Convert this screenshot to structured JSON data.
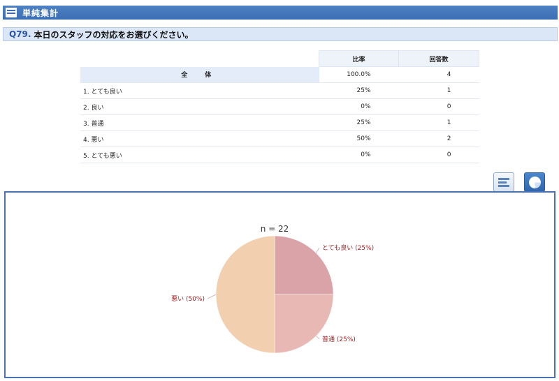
{
  "header": {
    "title": "単純集計",
    "icon": "list-icon"
  },
  "question": {
    "number": "Q79.",
    "text": "本日のスタッフの対応をお選びください。"
  },
  "table": {
    "columns": [
      "比率",
      "回答数"
    ],
    "total": {
      "label": "全　体",
      "ratio": "100.0%",
      "count": "4"
    },
    "rows": [
      {
        "label": "1. とても良い",
        "ratio": "25%",
        "count": "1"
      },
      {
        "label": "2. 良い",
        "ratio": "0%",
        "count": "0"
      },
      {
        "label": "3. 普通",
        "ratio": "25%",
        "count": "1"
      },
      {
        "label": "4. 悪い",
        "ratio": "50%",
        "count": "2"
      },
      {
        "label": "5. とても悪い",
        "ratio": "0%",
        "count": "0"
      }
    ]
  },
  "buttons": {
    "bar_view": "bar-chart-icon",
    "pie_view": "pie-chart-icon"
  },
  "chart_data": {
    "type": "pie",
    "title": "n = 22",
    "slices": [
      {
        "label": "とても良い (25%)",
        "value": 25,
        "color": "#d9a3a8"
      },
      {
        "label": "普通 (25%)",
        "value": 25,
        "color": "#e8b9b4"
      },
      {
        "label": "悪い (50%)",
        "value": 50,
        "color": "#f2cfae"
      }
    ],
    "label_color": "#a01f1f",
    "legend": "none"
  }
}
